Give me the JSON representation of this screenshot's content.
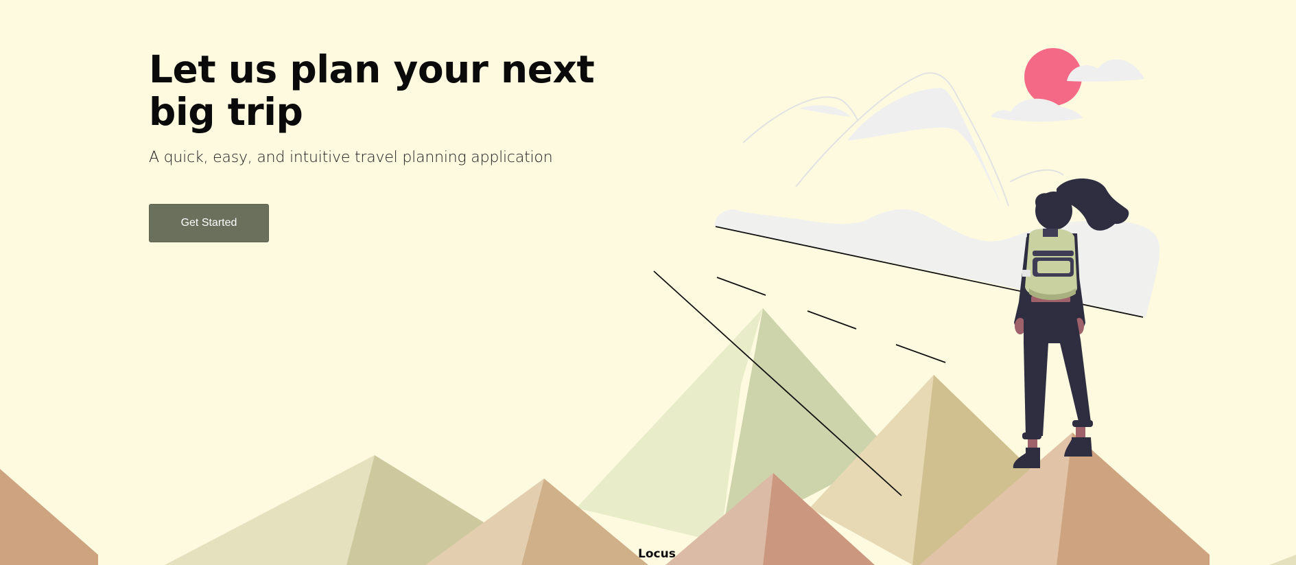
{
  "hero": {
    "title": "Let us plan your next big trip",
    "subtitle": "A quick, easy, and intuitive travel planning application",
    "cta_label": "Get Started"
  },
  "footer": {
    "brand": "Locus"
  },
  "colors": {
    "background": "#fdfae0",
    "button": "#6b705c",
    "sun": "#f46a86",
    "figure": "#2f2e41",
    "backpack": "#c9d1a0"
  },
  "illustration": {
    "icon": "hiker-on-mountain-illustration"
  }
}
